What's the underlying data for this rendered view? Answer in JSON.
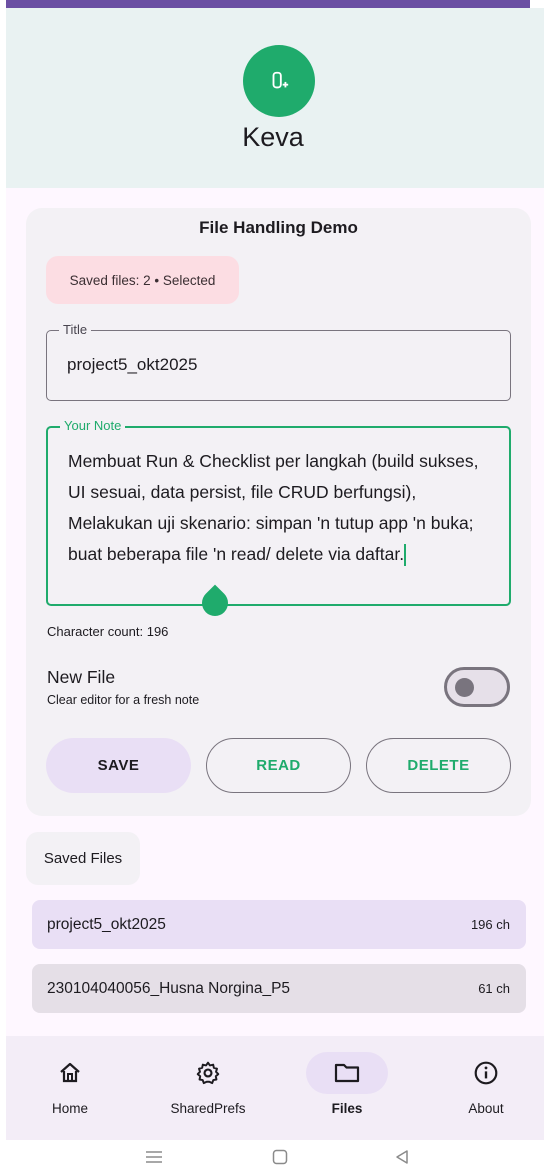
{
  "app": {
    "title": "Keva",
    "colors": {
      "accent": "#1fab6c",
      "status_bar": "#6b4fa3",
      "header_bg": "#e9f2f2",
      "chip_bg": "#fcdde3"
    },
    "icon": "clipboard-plus-icon"
  },
  "editor": {
    "section_title": "File Handling Demo",
    "chip_text": "Saved files: 2 • Selected",
    "title_field": {
      "label": "Title",
      "value": "project5_okt2025"
    },
    "note_field": {
      "label": "Your Note",
      "value": "Membuat Run & Checklist per langkah (build sukses, UI sesuai, data persist, file CRUD berfungsi), Melakukan uji skenario: simpan 'n tutup app 'n buka; buat beberapa file 'n read/ delete via daftar."
    },
    "char_count": "Character count: 196",
    "new_file": {
      "title": "New File",
      "subtitle": "Clear editor for a fresh note",
      "enabled": false
    },
    "buttons": {
      "save": "SAVE",
      "read": "READ",
      "delete": "DELETE"
    }
  },
  "saved_files": {
    "header": "Saved Files",
    "items": [
      {
        "name": "project5_okt2025",
        "size": "196 ch",
        "selected": true
      },
      {
        "name": "230104040056_Husna Norgina_P5",
        "size": "61 ch",
        "selected": false
      }
    ]
  },
  "bottom_nav": {
    "items": [
      {
        "label": "Home",
        "icon": "home-icon",
        "active": false
      },
      {
        "label": "SharedPrefs",
        "icon": "gear-icon",
        "active": false
      },
      {
        "label": "Files",
        "icon": "folder-icon",
        "active": true
      },
      {
        "label": "About",
        "icon": "info-icon",
        "active": false
      }
    ]
  },
  "system_nav": {
    "icons": [
      "menu-icon",
      "home-square-icon",
      "back-icon"
    ]
  }
}
